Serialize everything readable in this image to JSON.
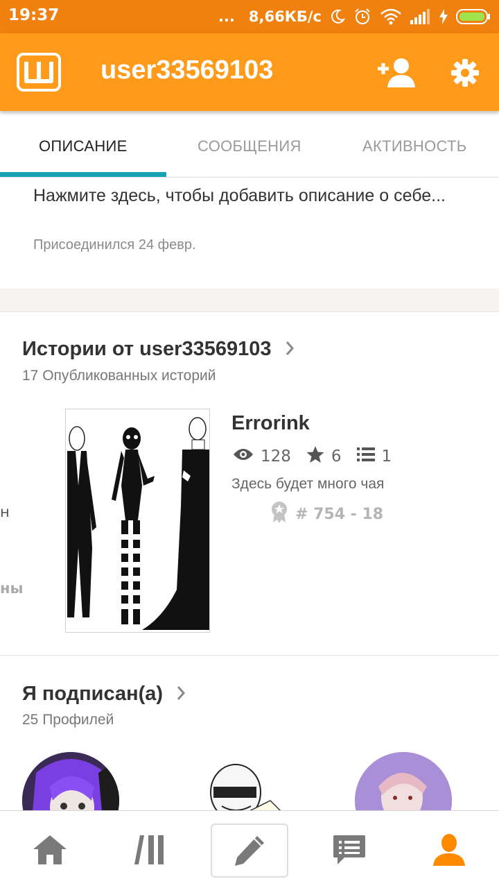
{
  "status_bar": {
    "time": "19:37",
    "dots": "...",
    "network_speed": "8,66КБ/с"
  },
  "app_bar": {
    "username": "user33569103",
    "icons": [
      "wattpad-logo-icon",
      "add-user-icon",
      "settings-gear-icon"
    ]
  },
  "tabs": [
    {
      "label": "ОПИСАНИЕ",
      "active": true
    },
    {
      "label": "СООБЩЕНИЯ",
      "active": false
    },
    {
      "label": "АКТИВНОСТЬ",
      "active": false
    }
  ],
  "profile": {
    "description_placeholder": "Нажмите здесь, чтобы добавить описание о себе...",
    "joined": "Присоединился 24 февр."
  },
  "stories_section": {
    "title": "Истории от user33569103",
    "subtitle": "17 Опубликованных историй",
    "peek_left_1": "н",
    "peek_left_2": "ны",
    "story": {
      "title": "Errorink",
      "views": "128",
      "votes": "6",
      "parts": "1",
      "description": "Здесь будет много чая",
      "rank": "# 754 - 18"
    }
  },
  "following_section": {
    "title": "Я подписан(а)",
    "subtitle": "25 Профилей"
  },
  "bottom_nav": [
    "home-icon",
    "library-icon",
    "write-icon",
    "messages-icon",
    "profile-icon"
  ],
  "colors": {
    "status_bar": "#f0810f",
    "app_bar": "#ff9a1a",
    "tab_indicator": "#16a3b3",
    "active_nav": "#ff8a00"
  }
}
